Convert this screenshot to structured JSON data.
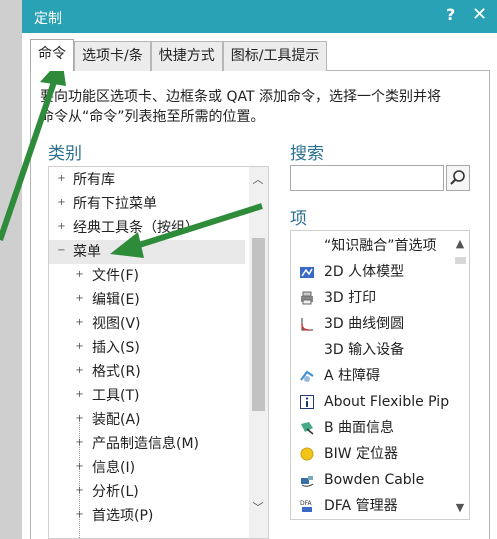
{
  "window": {
    "title": "定制",
    "help_label": "?",
    "close_label": "✕"
  },
  "tabs": [
    {
      "label": "命令"
    },
    {
      "label": "选项卡/条"
    },
    {
      "label": "快捷方式"
    },
    {
      "label": "图标/工具提示"
    }
  ],
  "instruction": {
    "line1": "要向功能区选项卡、边框条或 QAT 添加命令，选择一个类别并将",
    "line2": "命令从“命令”列表拖至所需的位置。"
  },
  "categories": {
    "title": "类别",
    "items": [
      {
        "label": "所有库",
        "expander": "+"
      },
      {
        "label": "所有下拉菜单",
        "expander": "+"
      },
      {
        "label": "经典工具条（按组）",
        "expander": "+"
      },
      {
        "label": "菜单",
        "expander": "−"
      },
      {
        "label": "文件(F)",
        "expander": "+"
      },
      {
        "label": "编辑(E)",
        "expander": "+"
      },
      {
        "label": "视图(V)",
        "expander": "+"
      },
      {
        "label": "插入(S)",
        "expander": "+"
      },
      {
        "label": "格式(R)",
        "expander": "+"
      },
      {
        "label": "工具(T)",
        "expander": "+"
      },
      {
        "label": "装配(A)",
        "expander": "+"
      },
      {
        "label": "产品制造信息(M)",
        "expander": "+"
      },
      {
        "label": "信息(I)",
        "expander": "+"
      },
      {
        "label": "分析(L)",
        "expander": "+"
      },
      {
        "label": "首选项(P)",
        "expander": "+"
      }
    ]
  },
  "search": {
    "title": "搜索",
    "value": "",
    "button_icon": "magnifier-icon"
  },
  "items": {
    "title": "项",
    "list": [
      {
        "label": "“知识融合”首选项",
        "icon": "blank"
      },
      {
        "label": "2D 人体模型",
        "icon": "human-model-icon"
      },
      {
        "label": "3D 打印",
        "icon": "printer-icon"
      },
      {
        "label": "3D 曲线倒圆",
        "icon": "curve-fillet-icon"
      },
      {
        "label": "3D 输入设备",
        "icon": "blank"
      },
      {
        "label": "A 柱障碍",
        "icon": "pillar-icon"
      },
      {
        "label": "About Flexible Pip",
        "icon": "info-icon"
      },
      {
        "label": "B 曲面信息",
        "icon": "surface-info-icon"
      },
      {
        "label": "BIW 定位器",
        "icon": "yellow-dot-icon"
      },
      {
        "label": "Bowden Cable",
        "icon": "cable-icon"
      },
      {
        "label": "DFA 管理器",
        "icon": "dfa-icon"
      }
    ]
  },
  "colors": {
    "accent": "#2aa2b6",
    "arrow": "#2e8b3a",
    "section_title": "#2b6f8f"
  }
}
